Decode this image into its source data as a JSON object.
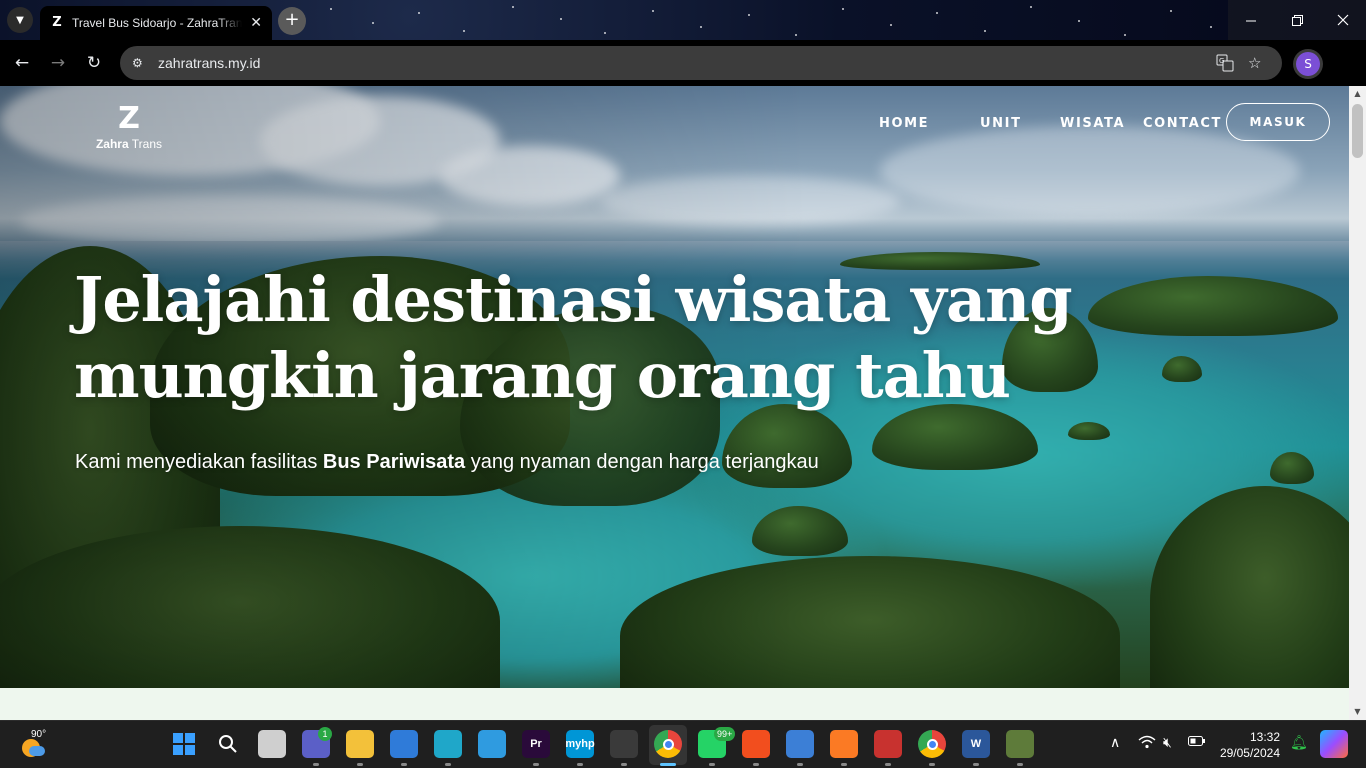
{
  "browser": {
    "tab_title": "Travel Bus Sidoarjo - ZahraTrans",
    "tab_favicon": "zahra-trans-icon",
    "url": "zahratrans.my.id",
    "profile_initial": "S",
    "tab_close": "✕",
    "new_tab": "+",
    "icons": [
      "tab-search-icon",
      "back-icon",
      "forward-icon",
      "reload-icon",
      "site-info-icon",
      "translate-icon",
      "bookmark-star-icon",
      "menu-dots-icon"
    ]
  },
  "site": {
    "logo_mark": "Z",
    "logo_bold": "Zahra",
    "logo_light": " Trans",
    "nav": [
      "HOME",
      "UNIT",
      "WISATA",
      "CONTACT"
    ],
    "login_label": "MASUK",
    "hero_title_line1": "Jelajahi destinasi wisata yang",
    "hero_title_line2": "mungkin jarang orang tahu",
    "hero_sub_before": "Kami menyediakan fasilitas ",
    "hero_sub_bold": "Bus Pariwisata",
    "hero_sub_after": " yang nyaman dengan harga terjangkau"
  },
  "taskbar": {
    "weather_temp": "90°",
    "apps": [
      {
        "name": "start",
        "color": "#3aa0ff"
      },
      {
        "name": "search",
        "color": "#ffffff"
      },
      {
        "name": "task-view",
        "color": "#cfcfcf"
      },
      {
        "name": "teams",
        "color": "#5b5fc7",
        "badge": "1"
      },
      {
        "name": "file-explorer",
        "color": "#f3c13a"
      },
      {
        "name": "microsoft-store",
        "color": "#2f7bd9"
      },
      {
        "name": "edge",
        "color": "#1fa7c9"
      },
      {
        "name": "get-help",
        "color": "#2f9be0"
      },
      {
        "name": "premiere-pro",
        "color": "#2a0a3a",
        "label": "Pr"
      },
      {
        "name": "myhp",
        "color": "#0096d6",
        "label": "myhp"
      },
      {
        "name": "inkscape",
        "color": "#3a3a3a"
      },
      {
        "name": "chrome",
        "color": "#e8453c"
      },
      {
        "name": "whatsapp",
        "color": "#25d366",
        "badge": "99+"
      },
      {
        "name": "figma",
        "color": "#f24e1e"
      },
      {
        "name": "virtualbox",
        "color": "#3c7fd6"
      },
      {
        "name": "xampp",
        "color": "#fb7a24"
      },
      {
        "name": "snipping-tool",
        "color": "#c8322f"
      },
      {
        "name": "chrome-profile-2",
        "color": "#34a853"
      },
      {
        "name": "word",
        "color": "#2b579a",
        "label": "W"
      },
      {
        "name": "app-extra",
        "color": "#5e7b3a"
      }
    ],
    "time": "13:32",
    "date": "29/05/2024"
  }
}
